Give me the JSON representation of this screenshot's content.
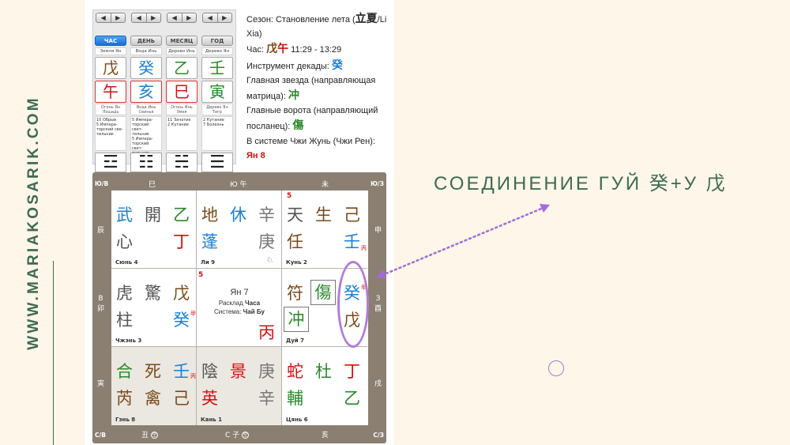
{
  "site": "WWW.MARIAKOSARIK.COM",
  "headline": "СОЕДИНЕНИЕ ГУЙ 癸+У 戊",
  "pillars": {
    "arrow_left": "◀",
    "arrow_right": "▶",
    "columns": [
      {
        "tab": "ЧАС",
        "active": true,
        "element": "Земля Ян",
        "stem": "戊",
        "branch": "午",
        "branch_name": "Огонь Ян\nЛошадь",
        "stars": "10 Обрыв\n5 Импера-\nторский све-\nтильник",
        "hexagram": "☲"
      },
      {
        "tab": "ДЕНЬ",
        "active": false,
        "element": "Вода Инь",
        "stem": "癸",
        "branch": "亥",
        "branch_name": "Вода Инь\nСвинья",
        "stars": "5 Импера-\nторский свет-\nтильник\n5 Импера-\nторский свет-\nтильник",
        "hexagram": "☷"
      },
      {
        "tab": "МЕСЯЦ",
        "active": false,
        "element": "Дерево Инь",
        "stem": "乙",
        "branch": "巳",
        "branch_name": "Огонь Инь\nЗмея",
        "stars": "11 Зачатие\n2 Кутание",
        "hexagram": "☵"
      },
      {
        "tab": "ГОД",
        "active": false,
        "element": "Дерево Ян",
        "stem": "壬",
        "branch": "寅",
        "branch_name": "Дерево Ян\nТигр",
        "stars": "2 Кутание\n7 Болезнь",
        "hexagram": "☰"
      }
    ]
  },
  "info": {
    "season_label": "Сезон: Становление лета (",
    "season_hz": "立夏",
    "season_suffix": "/Li Xia)",
    "hour_label": "Час:",
    "hour_stem": "戊",
    "hour_branch": "午",
    "hour_time": "11:29 - 13:29",
    "decade_label": "Инструмент декады:",
    "decade_value": "癸",
    "star_label": "Главная звезда (направляющая матрица):",
    "star_value": "冲",
    "gate_label": "Главные ворота (направляющий посланец):",
    "gate_value": "傷",
    "system_label": "В системе Чжи Жунь (Чжи Рен):",
    "system_value": "Ян 8"
  },
  "frame": {
    "top": [
      "巳",
      "Ю 午",
      "未"
    ],
    "bottom": [
      "丑",
      "С 子",
      "亥"
    ],
    "left": [
      "辰",
      "В\n卯",
      "寅"
    ],
    "right": [
      "申",
      "З\n酉",
      "戌"
    ],
    "corners": {
      "tl": "Ю/В",
      "tr": "Ю/З",
      "bl": "С/В",
      "br": "С/З"
    },
    "void_mark": "空"
  },
  "cells": {
    "xun": {
      "name": "Сюнь 4",
      "deity": "武",
      "door": "開",
      "heaven": "乙",
      "star": "心",
      "earth": "丁"
    },
    "li": {
      "name": "Ли 9",
      "deity": "地",
      "door": "休",
      "heaven": "辛",
      "star": "蓬",
      "earth": "庚"
    },
    "kun": {
      "name": "Кунь 2",
      "num": "5",
      "deity": "天",
      "door": "生",
      "heaven": "己",
      "star": "任",
      "earth": "壬",
      "sup": "丙"
    },
    "zhen": {
      "name": "Чжэнь 3",
      "deity": "虎",
      "door": "驚",
      "heaven": "戊",
      "star": "柱",
      "earth": "癸",
      "sup": "甲"
    },
    "center": {
      "num": "5",
      "title": "Ян 7",
      "line1_prefix": "Расклад ",
      "line1_value": "Часа",
      "line2_prefix": "Система: ",
      "line2_value": "Чай Бу",
      "stem": "丙"
    },
    "dui": {
      "name": "Дуй 7",
      "deity": "符",
      "door": "傷",
      "heaven": "癸",
      "star": "冲",
      "earth": "戊",
      "sup": "甲"
    },
    "gen": {
      "name": "Гэнь 8",
      "deity": "合",
      "door": "死",
      "heaven": "壬",
      "star": "芮",
      "earth_a": "禽",
      "earth": "己",
      "sup": "丙"
    },
    "kan": {
      "name": "Кань 1",
      "deity": "陰",
      "door": "景",
      "heaven": "庚",
      "star": "英",
      "earth": "辛"
    },
    "qian": {
      "name": "Цянь 6",
      "deity": "蛇",
      "door": "杜",
      "heaven": "丁",
      "star": "輔",
      "earth": "乙"
    }
  }
}
